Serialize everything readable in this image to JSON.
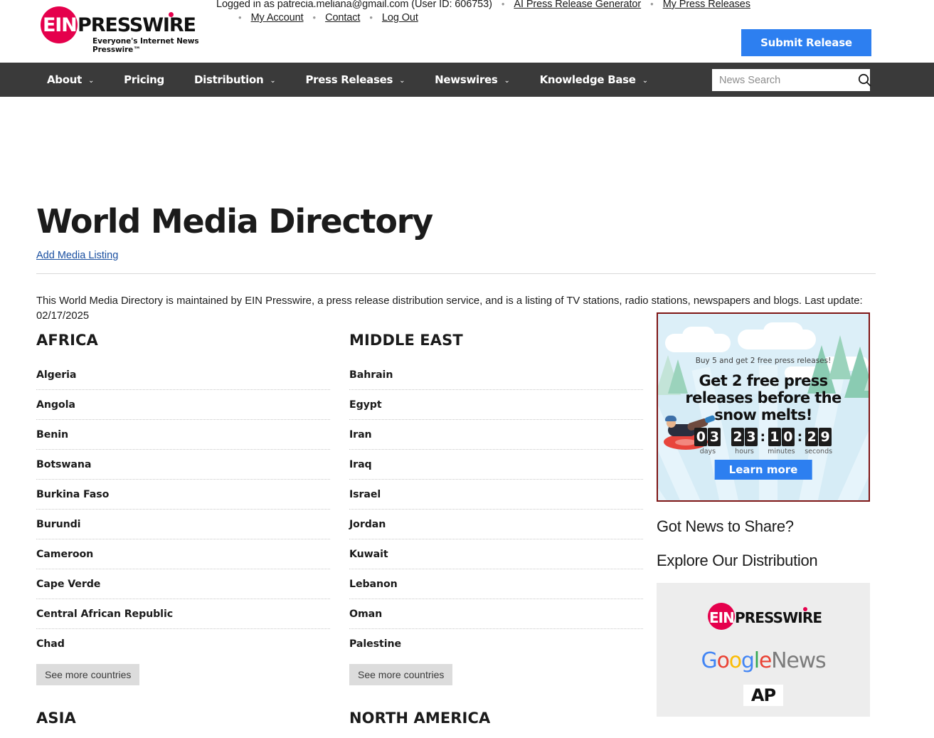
{
  "brand": {
    "logo_ein": "EIN",
    "logo_presswire": "PRESSWIRE",
    "tagline": "Everyone's Internet News Presswire™",
    "accent_color": "#E5004C",
    "button_color": "#2D7FF0"
  },
  "header": {
    "logged_in_text": "Logged in as patrecia.meliana@gmail.com (User ID: 606753)",
    "links_row1": [
      "AI Press Release Generator",
      "My Press Releases"
    ],
    "links_row2": [
      "My Account",
      "Contact",
      "Log Out"
    ],
    "submit_label": "Submit Release",
    "bullet": "•"
  },
  "nav": {
    "items": [
      {
        "label": "About",
        "caret": true
      },
      {
        "label": "Pricing",
        "caret": false
      },
      {
        "label": "Distribution",
        "caret": true
      },
      {
        "label": "Press Releases",
        "caret": true
      },
      {
        "label": "Newswires",
        "caret": true
      },
      {
        "label": "Knowledge Base",
        "caret": true
      }
    ],
    "search_placeholder": "News Search",
    "search_value": "",
    "bar_color": "#3a3a3a"
  },
  "main": {
    "title": "World Media Directory",
    "add_listing_label": "Add Media Listing",
    "intro": "This World Media Directory is maintained by EIN Presswire, a press release distribution service, and is a listing of TV stations, radio stations, newspapers and blogs. Last update: 02/17/2025",
    "see_more_label": "See more countries",
    "regions": [
      {
        "name": "AFRICA",
        "countries": [
          "Algeria",
          "Angola",
          "Benin",
          "Botswana",
          "Burkina Faso",
          "Burundi",
          "Cameroon",
          "Cape Verde",
          "Central African Republic",
          "Chad"
        ]
      },
      {
        "name": "MIDDLE EAST",
        "countries": [
          "Bahrain",
          "Egypt",
          "Iran",
          "Iraq",
          "Israel",
          "Jordan",
          "Kuwait",
          "Lebanon",
          "Oman",
          "Palestine"
        ]
      }
    ],
    "next_regions": [
      "ASIA",
      "NORTH AMERICA"
    ]
  },
  "sidebar": {
    "ad": {
      "subhead": "Buy 5 and get 2 free press releases!",
      "headline": "Get 2 free press releases before the snow melts!",
      "cta_label": "Learn more",
      "border_color": "#7E1515",
      "countdown": [
        {
          "value": "03",
          "label": "days"
        },
        {
          "value": "23",
          "label": "hours"
        },
        {
          "value": "10",
          "label": "minutes"
        },
        {
          "value": "29",
          "label": "seconds"
        }
      ],
      "separator": ":"
    },
    "got_news_heading": "Got News to Share?",
    "explore_heading": "Explore Our Distribution",
    "distribution_logos": [
      {
        "name": "EIN Presswire",
        "ein": "EIN",
        "presswire": "PRESSWIRE"
      },
      {
        "name": "Google News",
        "google": [
          "G",
          "o",
          "o",
          "g",
          "l",
          "e"
        ],
        "word": "News"
      },
      {
        "name": "AP",
        "text": "AP"
      }
    ]
  }
}
